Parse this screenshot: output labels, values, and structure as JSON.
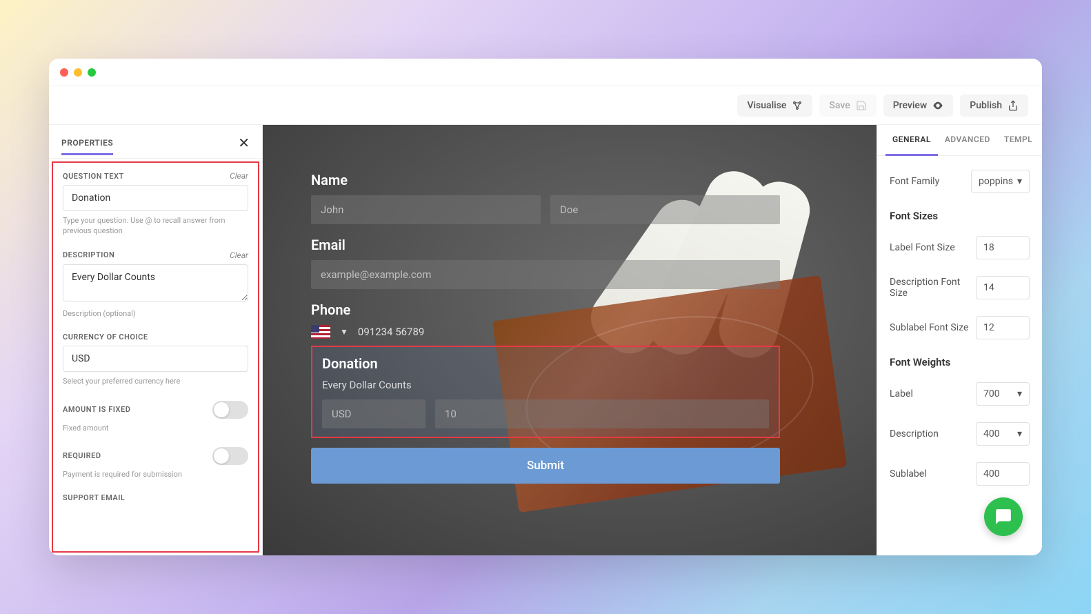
{
  "toolbar": {
    "visualise": "Visualise",
    "save": "Save",
    "preview": "Preview",
    "publish": "Publish"
  },
  "left": {
    "title": "PROPERTIES",
    "questionText": {
      "label": "QUESTION TEXT",
      "clear": "Clear",
      "value": "Donation",
      "help": "Type your question. Use @ to recall answer from previous question"
    },
    "description": {
      "label": "DESCRIPTION",
      "clear": "Clear",
      "value": "Every Dollar Counts",
      "help": "Description (optional)"
    },
    "currency": {
      "label": "CURRENCY OF CHOICE",
      "value": "USD",
      "help": "Select your preferred currency here"
    },
    "amountFixed": {
      "label": "AMOUNT IS FIXED",
      "help": "Fixed amount"
    },
    "required": {
      "label": "REQUIRED",
      "help": "Payment is required for submission"
    },
    "supportEmail": {
      "label": "SUPPORT EMAIL"
    }
  },
  "form": {
    "name": {
      "label": "Name",
      "first": "John",
      "last": "Doe"
    },
    "email": {
      "label": "Email",
      "placeholder": "example@example.com"
    },
    "phone": {
      "label": "Phone",
      "value": "091234 56789"
    },
    "donation": {
      "label": "Donation",
      "desc": "Every Dollar Counts",
      "currency": "USD",
      "amount": "10"
    },
    "submit": "Submit"
  },
  "right": {
    "tabs": {
      "general": "GENERAL",
      "advanced": "ADVANCED",
      "template": "TEMPL"
    },
    "fontFamily": {
      "label": "Font Family",
      "value": "poppins"
    },
    "fontSizes": {
      "title": "Font Sizes",
      "label": {
        "label": "Label Font Size",
        "value": "18"
      },
      "desc": {
        "label": "Description Font Size",
        "value": "14"
      },
      "sub": {
        "label": "Sublabel Font Size",
        "value": "12"
      }
    },
    "fontWeights": {
      "title": "Font Weights",
      "label": {
        "label": "Label",
        "value": "700"
      },
      "desc": {
        "label": "Description",
        "value": "400"
      },
      "sub": {
        "label": "Sublabel",
        "value": "400"
      }
    }
  }
}
